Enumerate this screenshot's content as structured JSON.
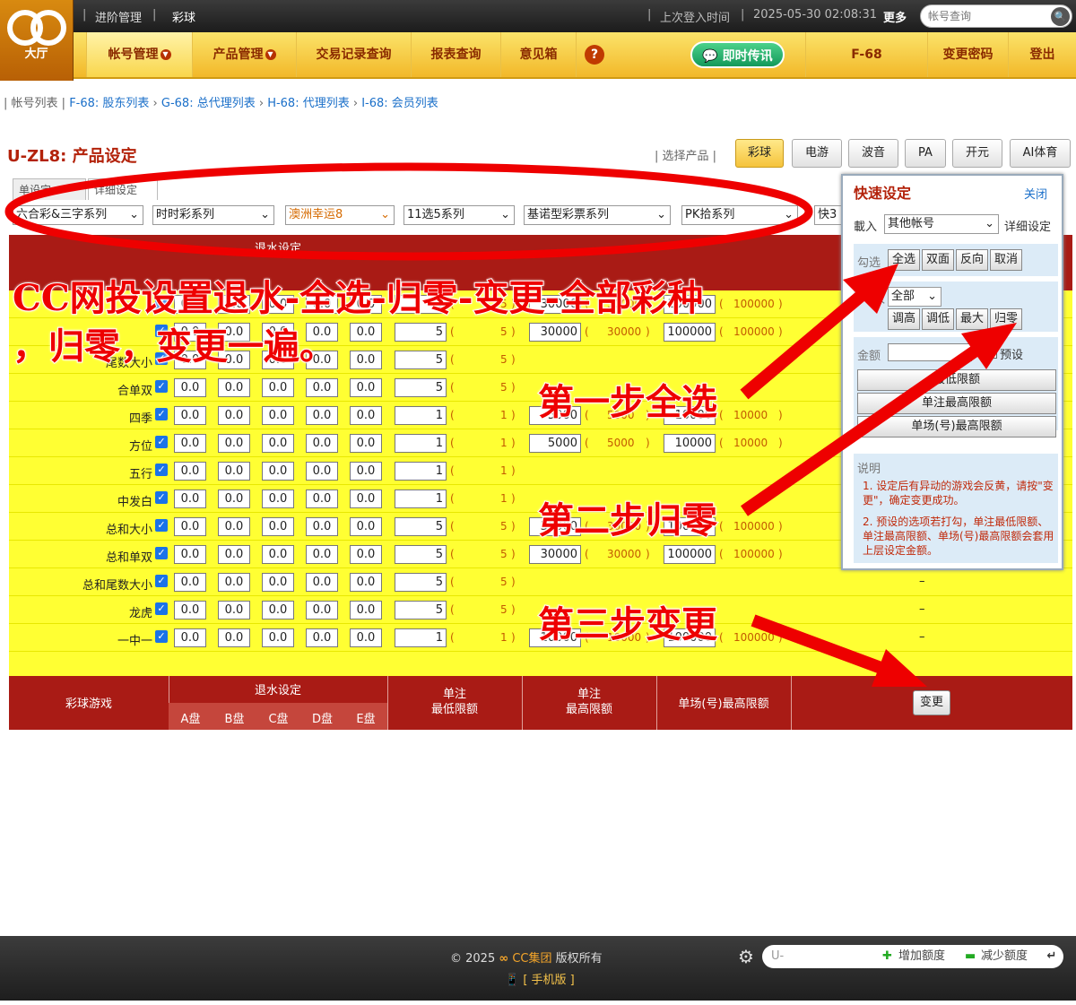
{
  "header": {
    "logo_text": "大厅",
    "path_prefix": "进阶管理",
    "path_current": "彩球",
    "last_login_label": "上次登入时间",
    "last_login_time": "2025-05-30 02:08:31",
    "more_label": "更多",
    "search_placeholder": "帐号查询"
  },
  "nav": {
    "items": [
      "帐号管理",
      "产品管理",
      "交易记录查询",
      "报表查询",
      "意见箱"
    ],
    "im_label": "即时传讯",
    "user_code": "F-68",
    "change_password": "变更密码",
    "logout": "登出"
  },
  "breadcrumb": {
    "root": "帐号列表",
    "links": [
      "F-68: 股东列表",
      "G-68: 总代理列表",
      "H-68: 代理列表",
      "I-68: 会员列表"
    ]
  },
  "page": {
    "title": "U-ZL8: 产品设定",
    "select_product_label": "选择产品",
    "products": [
      "彩球",
      "电游",
      "波音",
      "PA",
      "开元",
      "AI体育"
    ],
    "active_product": "彩球"
  },
  "tabs": {
    "basic": "单设定",
    "detail": "详细设定"
  },
  "series_selects": [
    "六合彩&三字系列",
    "时时彩系列",
    "澳洲幸运8",
    "11选5系列",
    "基诺型彩票系列",
    "PK拾系列",
    "快3"
  ],
  "table": {
    "header_game": "彩球游戏",
    "header_rebate": "退水设定",
    "plates": [
      "A盘",
      "B盘",
      "C盘",
      "D盘",
      "E盘"
    ],
    "header_min": "单注\n最低限额",
    "header_max": "单注\n最高限额",
    "header_single": "单场(号)最高限额",
    "rows": [
      {
        "name": "",
        "rebate": [
          "0.0",
          "0.0",
          "0.0",
          "0.0",
          "0.0"
        ],
        "min": "5",
        "min_ref": "5",
        "max": "30000",
        "max_ref": "30000",
        "single": "100000",
        "single_ref": "100000"
      },
      {
        "name": "",
        "rebate": [
          "0.0",
          "0.0",
          "0.0",
          "0.0",
          "0.0"
        ],
        "min": "5",
        "min_ref": "5",
        "max": "30000",
        "max_ref": "30000",
        "single": "100000",
        "single_ref": "100000"
      },
      {
        "name": "尾数大小",
        "rebate": [
          "0.0",
          "0.0",
          "0.0",
          "0.0",
          "0.0"
        ],
        "min": "5",
        "min_ref": "5",
        "max": "",
        "max_ref": "",
        "single": "",
        "single_ref": ""
      },
      {
        "name": "合单双",
        "rebate": [
          "0.0",
          "0.0",
          "0.0",
          "0.0",
          "0.0"
        ],
        "min": "5",
        "min_ref": "5",
        "max": "",
        "max_ref": "",
        "single": "",
        "single_ref": ""
      },
      {
        "name": "四季",
        "rebate": [
          "0.0",
          "0.0",
          "0.0",
          "0.0",
          "0.0"
        ],
        "min": "1",
        "min_ref": "1",
        "max": "5000",
        "max_ref": "5000",
        "single": "10000",
        "single_ref": "10000"
      },
      {
        "name": "方位",
        "rebate": [
          "0.0",
          "0.0",
          "0.0",
          "0.0",
          "0.0"
        ],
        "min": "1",
        "min_ref": "1",
        "max": "5000",
        "max_ref": "5000",
        "single": "10000",
        "single_ref": "10000"
      },
      {
        "name": "五行",
        "rebate": [
          "0.0",
          "0.0",
          "0.0",
          "0.0",
          "0.0"
        ],
        "min": "1",
        "min_ref": "1",
        "max": "",
        "max_ref": "",
        "single": "",
        "single_ref": ""
      },
      {
        "name": "中发白",
        "rebate": [
          "0.0",
          "0.0",
          "0.0",
          "0.0",
          "0.0"
        ],
        "min": "1",
        "min_ref": "1",
        "max": "",
        "max_ref": "",
        "single": "",
        "single_ref": ""
      },
      {
        "name": "总和大小",
        "rebate": [
          "0.0",
          "0.0",
          "0.0",
          "0.0",
          "0.0"
        ],
        "min": "5",
        "min_ref": "5",
        "max": "30000",
        "max_ref": "30000",
        "single": "100000",
        "single_ref": "100000"
      },
      {
        "name": "总和单双",
        "rebate": [
          "0.0",
          "0.0",
          "0.0",
          "0.0",
          "0.0"
        ],
        "min": "5",
        "min_ref": "5",
        "max": "30000",
        "max_ref": "30000",
        "single": "100000",
        "single_ref": "100000"
      },
      {
        "name": "总和尾数大小",
        "rebate": [
          "0.0",
          "0.0",
          "0.0",
          "0.0",
          "0.0"
        ],
        "min": "5",
        "min_ref": "5",
        "max": "",
        "max_ref": "",
        "single": "",
        "single_ref": ""
      },
      {
        "name": "龙虎",
        "rebate": [
          "0.0",
          "0.0",
          "0.0",
          "0.0",
          "0.0"
        ],
        "min": "5",
        "min_ref": "5",
        "max": "",
        "max_ref": "",
        "single": "",
        "single_ref": ""
      },
      {
        "name": "一中一",
        "rebate": [
          "0.0",
          "0.0",
          "0.0",
          "0.0",
          "0.0"
        ],
        "min": "1",
        "min_ref": "1",
        "max": "10000",
        "max_ref": "10000",
        "single": "100000",
        "single_ref": "100000"
      }
    ],
    "dash": "–",
    "change_button": "变更"
  },
  "quick": {
    "title": "快速设定",
    "close": "关闭",
    "load_label": "載入",
    "load_value": "其他帐号",
    "detail_link": "详细设定",
    "check_label": "勾选",
    "check_buttons": [
      "全选",
      "双面",
      "反向",
      "取消"
    ],
    "water_label": "水",
    "water_value": "全部",
    "water_buttons": [
      "调高",
      "调低",
      "最大",
      "归零"
    ],
    "amount_label": "金额",
    "preset_label": "预设",
    "limit_buttons": [
      "最低限额",
      "单注最高限额",
      "单场(号)最高限额"
    ],
    "notes_title": "说明",
    "notes": [
      "1. 设定后有异动的游戏会反黄，请按\"变更\"，确定变更成功。",
      "2. 预设的选项若打勾，单注最低限额、单注最高限额、单场(号)最高限额会套用上层设定金额。"
    ]
  },
  "annotations": {
    "headline_1": "CC网投设置退水-全选-归零-变更-全部彩种",
    "headline_2": "，归零，变更一遍。",
    "step1": "第一步全选",
    "step2": "第二步归零",
    "step3": "第三步变更",
    "color": "#e00000"
  },
  "footer": {
    "copyright": "© 2025",
    "brand": "CC集团",
    "rights": "版权所有",
    "mobile": "[ 手机版 ]",
    "user_prefix": "U-",
    "add_credit": "增加额度",
    "reduce_credit": "减少额度"
  }
}
